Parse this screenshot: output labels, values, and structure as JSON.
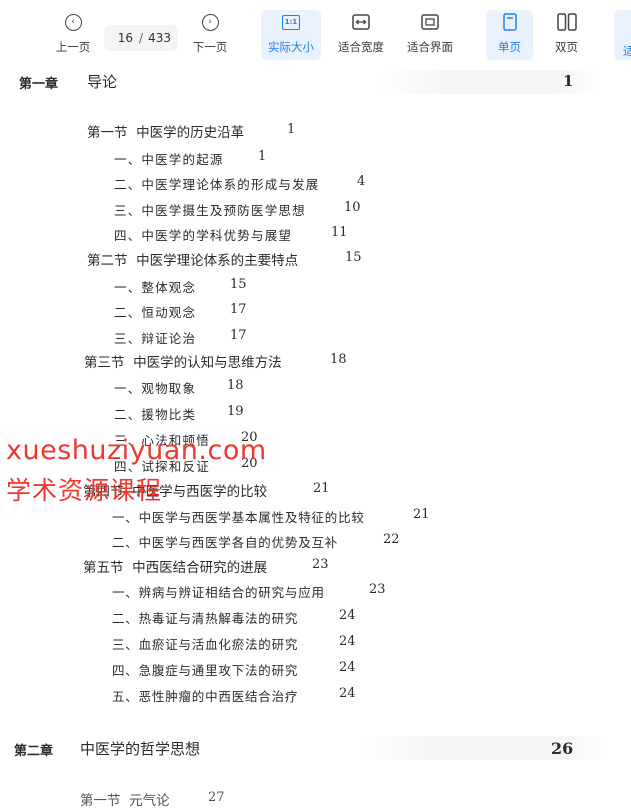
{
  "toolbar": {
    "prev_label": "上一页",
    "next_label": "下一页",
    "current_page": "16",
    "page_separator": "/",
    "total_pages": "433",
    "actual_size_icon_text": "1:1",
    "actual_size_label": "实际大小",
    "fit_width_label": "适合宽度",
    "fit_page_label": "适合界面",
    "single_page_label": "单页",
    "double_page_label": "双页",
    "edge_label": "适",
    "accent_color": "#1f7ff2"
  },
  "toc": {
    "chapter1": {
      "label": "第一章",
      "title": "导论",
      "page": "1"
    },
    "sections": [
      {
        "label": "第一节",
        "title": "中医学的历史沿革",
        "page": "1"
      },
      {
        "label": "第二节",
        "title": "中医学理论体系的主要特点",
        "page": "15"
      },
      {
        "label": "第三节",
        "title": "中医学的认知与思维方法",
        "page": "18"
      },
      {
        "label": "第四节",
        "title": "中医学与西医学的比较",
        "page": "21"
      },
      {
        "label": "第五节",
        "title": "中西医结合研究的进展",
        "page": "23"
      }
    ],
    "items": [
      {
        "text": "一、中医学的起源",
        "page": "1"
      },
      {
        "text": "二、中医学理论体系的形成与发展",
        "page": "4"
      },
      {
        "text": "三、中医学摄生及预防医学思想",
        "page": "10"
      },
      {
        "text": "四、中医学的学科优势与展望",
        "page": "11"
      },
      {
        "text": "一、整体观念",
        "page": "15"
      },
      {
        "text": "二、恒动观念",
        "page": "17"
      },
      {
        "text": "三、辩证论治",
        "page": "17"
      },
      {
        "text": "一、观物取象",
        "page": "18"
      },
      {
        "text": "二、援物比类",
        "page": "19"
      },
      {
        "text": "三、心法和顿悟",
        "page": "20"
      },
      {
        "text": "四、试探和反证",
        "page": "20"
      },
      {
        "text": "一、中医学与西医学基本属性及特征的比较",
        "page": "21"
      },
      {
        "text": "二、中医学与西医学各自的优势及互补",
        "page": "22"
      },
      {
        "text": "一、辨病与辨证相结合的研究与应用",
        "page": "23"
      },
      {
        "text": "二、热毒证与清热解毒法的研究",
        "page": "24"
      },
      {
        "text": "三、血瘀证与活血化瘀法的研究",
        "page": "24"
      },
      {
        "text": "四、急腹症与通里攻下法的研究",
        "page": "24"
      },
      {
        "text": "五、恶性肿瘤的中西医结合治疗",
        "page": "24"
      }
    ],
    "chapter2": {
      "label": "第二章",
      "title": "中医学的哲学思想",
      "page": "26"
    },
    "ch2_section": {
      "label": "第一节",
      "title": "元气论",
      "page": "27"
    }
  },
  "watermark": {
    "line1": "xueshuziyuan.com",
    "line2": "学术资源课程",
    "color": "#ec2a22"
  }
}
